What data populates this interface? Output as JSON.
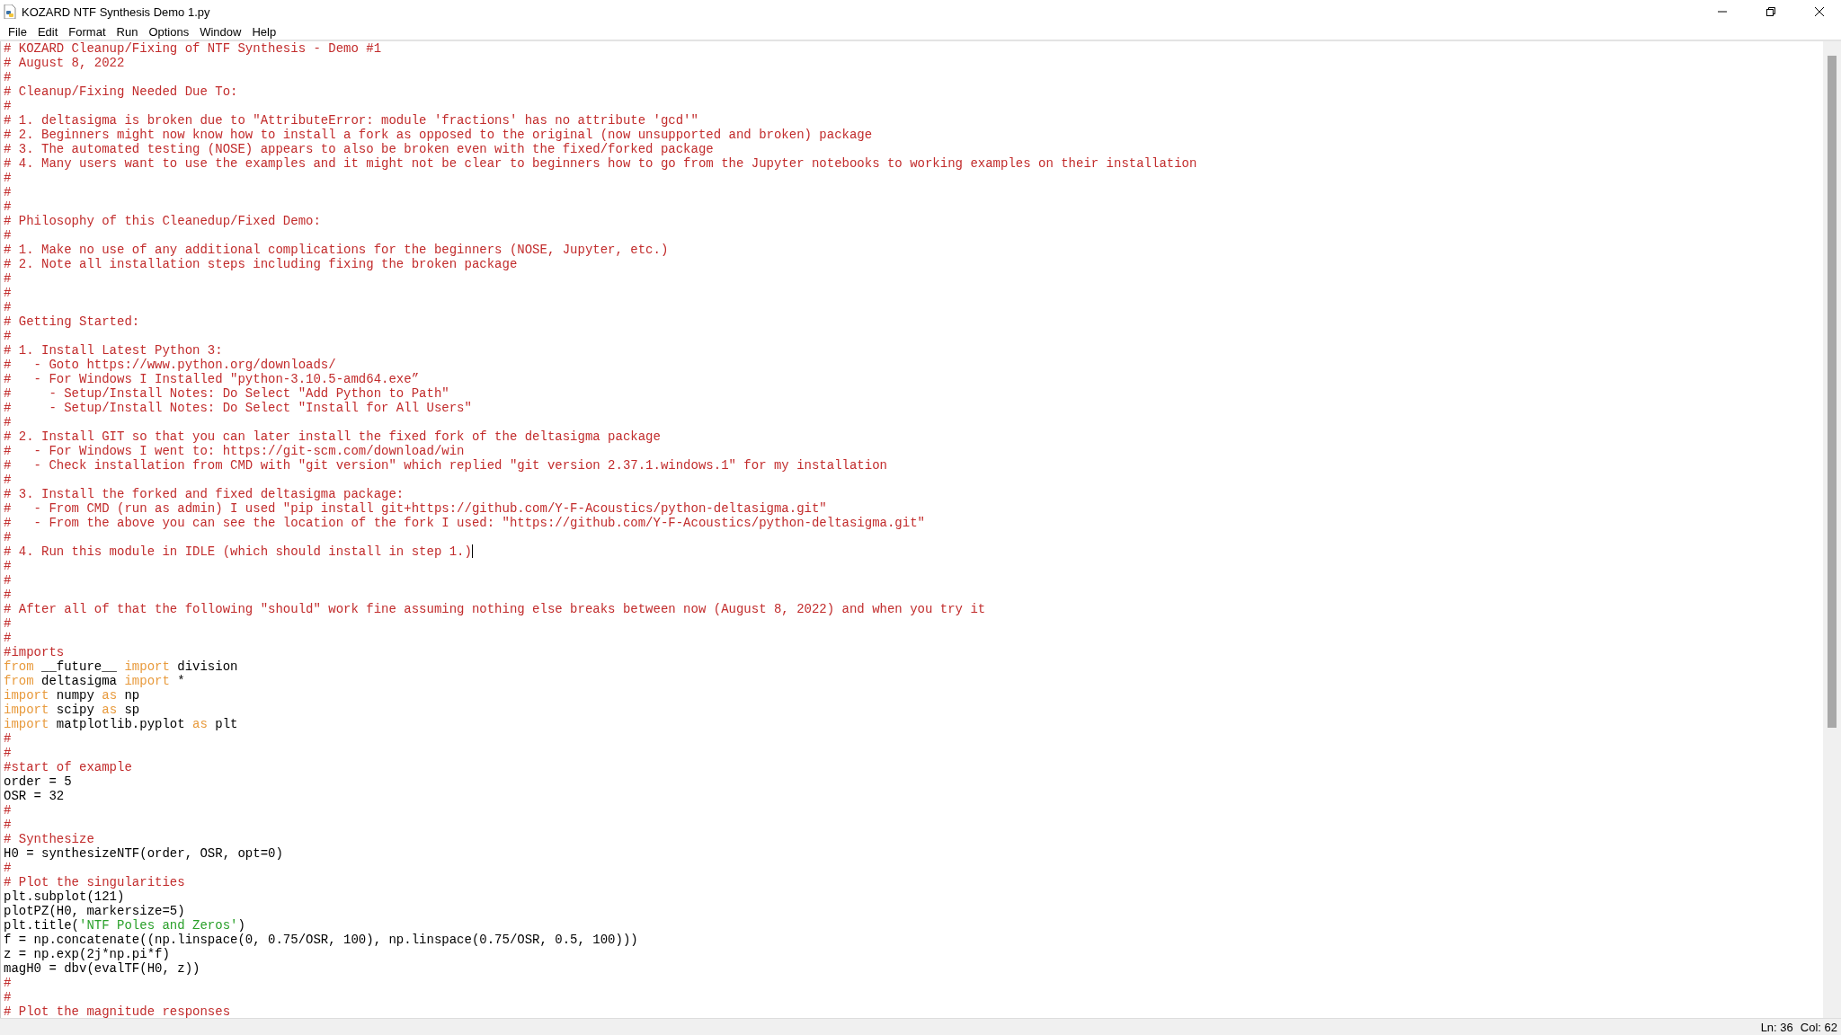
{
  "window": {
    "title": "KOZARD NTF Synthesis Demo 1.py"
  },
  "menu": [
    "File",
    "Edit",
    "Format",
    "Run",
    "Options",
    "Window",
    "Help"
  ],
  "lines": [
    {
      "tokens": [
        {
          "kind": "comment",
          "text": "# KOZARD Cleanup/Fixing of NTF Synthesis - Demo #1"
        }
      ]
    },
    {
      "tokens": [
        {
          "kind": "comment",
          "text": "# August 8, 2022"
        }
      ]
    },
    {
      "tokens": [
        {
          "kind": "comment",
          "text": "#"
        }
      ]
    },
    {
      "tokens": [
        {
          "kind": "comment",
          "text": "# Cleanup/Fixing Needed Due To:"
        }
      ]
    },
    {
      "tokens": [
        {
          "kind": "comment",
          "text": "#"
        }
      ]
    },
    {
      "tokens": [
        {
          "kind": "comment",
          "text": "# 1. deltasigma is broken due to \"AttributeError: module 'fractions' has no attribute 'gcd'\""
        }
      ]
    },
    {
      "tokens": [
        {
          "kind": "comment",
          "text": "# 2. Beginners might now know how to install a fork as opposed to the original (now unsupported and broken) package"
        }
      ]
    },
    {
      "tokens": [
        {
          "kind": "comment",
          "text": "# 3. The automated testing (NOSE) appears to also be broken even with the fixed/forked package"
        }
      ]
    },
    {
      "tokens": [
        {
          "kind": "comment",
          "text": "# 4. Many users want to use the examples and it might not be clear to beginners how to go from the Jupyter notebooks to working examples on their installation"
        }
      ]
    },
    {
      "tokens": [
        {
          "kind": "comment",
          "text": "#"
        }
      ]
    },
    {
      "tokens": [
        {
          "kind": "comment",
          "text": "#"
        }
      ]
    },
    {
      "tokens": [
        {
          "kind": "comment",
          "text": "#"
        }
      ]
    },
    {
      "tokens": [
        {
          "kind": "comment",
          "text": "# Philosophy of this Cleanedup/Fixed Demo:"
        }
      ]
    },
    {
      "tokens": [
        {
          "kind": "comment",
          "text": "#"
        }
      ]
    },
    {
      "tokens": [
        {
          "kind": "comment",
          "text": "# 1. Make no use of any additional complications for the beginners (NOSE, Jupyter, etc.)"
        }
      ]
    },
    {
      "tokens": [
        {
          "kind": "comment",
          "text": "# 2. Note all installation steps including fixing the broken package"
        }
      ]
    },
    {
      "tokens": [
        {
          "kind": "comment",
          "text": "#"
        }
      ]
    },
    {
      "tokens": [
        {
          "kind": "comment",
          "text": "#"
        }
      ]
    },
    {
      "tokens": [
        {
          "kind": "comment",
          "text": "#"
        }
      ]
    },
    {
      "tokens": [
        {
          "kind": "comment",
          "text": "# Getting Started:"
        }
      ]
    },
    {
      "tokens": [
        {
          "kind": "comment",
          "text": "#"
        }
      ]
    },
    {
      "tokens": [
        {
          "kind": "comment",
          "text": "# 1. Install Latest Python 3:"
        }
      ]
    },
    {
      "tokens": [
        {
          "kind": "comment",
          "text": "#   - Goto https://www.python.org/downloads/"
        }
      ]
    },
    {
      "tokens": [
        {
          "kind": "comment",
          "text": "#   - For Windows I Installed \"python-3.10.5-amd64.exe”"
        }
      ]
    },
    {
      "tokens": [
        {
          "kind": "comment",
          "text": "#     - Setup/Install Notes: Do Select \"Add Python to Path\""
        }
      ]
    },
    {
      "tokens": [
        {
          "kind": "comment",
          "text": "#     - Setup/Install Notes: Do Select \"Install for All Users\""
        }
      ]
    },
    {
      "tokens": [
        {
          "kind": "comment",
          "text": "#"
        }
      ]
    },
    {
      "tokens": [
        {
          "kind": "comment",
          "text": "# 2. Install GIT so that you can later install the fixed fork of the deltasigma package"
        }
      ]
    },
    {
      "tokens": [
        {
          "kind": "comment",
          "text": "#   - For Windows I went to: https://git-scm.com/download/win"
        }
      ]
    },
    {
      "tokens": [
        {
          "kind": "comment",
          "text": "#   - Check installation from CMD with \"git version\" which replied \"git version 2.37.1.windows.1\" for my installation"
        }
      ]
    },
    {
      "tokens": [
        {
          "kind": "comment",
          "text": "#"
        }
      ]
    },
    {
      "tokens": [
        {
          "kind": "comment",
          "text": "# 3. Install the forked and fixed deltasigma package:"
        }
      ]
    },
    {
      "tokens": [
        {
          "kind": "comment",
          "text": "#   - From CMD (run as admin) I used \"pip install git+https://github.com/Y-F-Acoustics/python-deltasigma.git\""
        }
      ]
    },
    {
      "tokens": [
        {
          "kind": "comment",
          "text": "#   - From the above you can see the location of the fork I used: \"https://github.com/Y-F-Acoustics/python-deltasigma.git\""
        }
      ]
    },
    {
      "tokens": [
        {
          "kind": "comment",
          "text": "#"
        }
      ]
    },
    {
      "tokens": [
        {
          "kind": "comment",
          "text": "# 4. Run this module in IDLE (which should install in step 1.)"
        }
      ],
      "caret": true
    },
    {
      "tokens": [
        {
          "kind": "comment",
          "text": "#"
        }
      ]
    },
    {
      "tokens": [
        {
          "kind": "comment",
          "text": "#"
        }
      ]
    },
    {
      "tokens": [
        {
          "kind": "comment",
          "text": "#"
        }
      ]
    },
    {
      "tokens": [
        {
          "kind": "comment",
          "text": "# After all of that the following \"should\" work fine assuming nothing else breaks between now (August 8, 2022) and when you try it"
        }
      ]
    },
    {
      "tokens": [
        {
          "kind": "comment",
          "text": "#"
        }
      ]
    },
    {
      "tokens": [
        {
          "kind": "comment",
          "text": "#"
        }
      ]
    },
    {
      "tokens": [
        {
          "kind": "comment",
          "text": "#imports"
        }
      ]
    },
    {
      "tokens": [
        {
          "kind": "keyword",
          "text": "from"
        },
        {
          "kind": "plain",
          "text": " __future__ "
        },
        {
          "kind": "keyword",
          "text": "import"
        },
        {
          "kind": "plain",
          "text": " division"
        }
      ]
    },
    {
      "tokens": [
        {
          "kind": "keyword",
          "text": "from"
        },
        {
          "kind": "plain",
          "text": " deltasigma "
        },
        {
          "kind": "keyword",
          "text": "import"
        },
        {
          "kind": "plain",
          "text": " *"
        }
      ]
    },
    {
      "tokens": [
        {
          "kind": "keyword",
          "text": "import"
        },
        {
          "kind": "plain",
          "text": " numpy "
        },
        {
          "kind": "keyword",
          "text": "as"
        },
        {
          "kind": "plain",
          "text": " np"
        }
      ]
    },
    {
      "tokens": [
        {
          "kind": "keyword",
          "text": "import"
        },
        {
          "kind": "plain",
          "text": " scipy "
        },
        {
          "kind": "keyword",
          "text": "as"
        },
        {
          "kind": "plain",
          "text": " sp"
        }
      ]
    },
    {
      "tokens": [
        {
          "kind": "keyword",
          "text": "import"
        },
        {
          "kind": "plain",
          "text": " matplotlib.pyplot "
        },
        {
          "kind": "keyword",
          "text": "as"
        },
        {
          "kind": "plain",
          "text": " plt"
        }
      ]
    },
    {
      "tokens": [
        {
          "kind": "comment",
          "text": "#"
        }
      ]
    },
    {
      "tokens": [
        {
          "kind": "comment",
          "text": "#"
        }
      ]
    },
    {
      "tokens": [
        {
          "kind": "comment",
          "text": "#start of example"
        }
      ]
    },
    {
      "tokens": [
        {
          "kind": "plain",
          "text": "order = 5"
        }
      ]
    },
    {
      "tokens": [
        {
          "kind": "plain",
          "text": "OSR = 32"
        }
      ]
    },
    {
      "tokens": [
        {
          "kind": "comment",
          "text": "#"
        }
      ]
    },
    {
      "tokens": [
        {
          "kind": "comment",
          "text": "#"
        }
      ]
    },
    {
      "tokens": [
        {
          "kind": "comment",
          "text": "# Synthesize"
        }
      ]
    },
    {
      "tokens": [
        {
          "kind": "plain",
          "text": "H0 = synthesizeNTF(order, OSR, opt=0)"
        }
      ]
    },
    {
      "tokens": [
        {
          "kind": "comment",
          "text": "#"
        }
      ]
    },
    {
      "tokens": [
        {
          "kind": "comment",
          "text": "# Plot the singularities"
        }
      ]
    },
    {
      "tokens": [
        {
          "kind": "plain",
          "text": "plt.subplot(121)"
        }
      ]
    },
    {
      "tokens": [
        {
          "kind": "plain",
          "text": "plotPZ(H0, markersize=5)"
        }
      ]
    },
    {
      "tokens": [
        {
          "kind": "plain",
          "text": "plt.title("
        },
        {
          "kind": "string",
          "text": "'NTF Poles and Zeros'"
        },
        {
          "kind": "plain",
          "text": ")"
        }
      ]
    },
    {
      "tokens": [
        {
          "kind": "plain",
          "text": "f = np.concatenate((np.linspace(0, 0.75/OSR, 100), np.linspace(0.75/OSR, 0.5, 100)))"
        }
      ]
    },
    {
      "tokens": [
        {
          "kind": "plain",
          "text": "z = np.exp(2j*np.pi*f)"
        }
      ]
    },
    {
      "tokens": [
        {
          "kind": "plain",
          "text": "magH0 = dbv(evalTF(H0, z))"
        }
      ]
    },
    {
      "tokens": [
        {
          "kind": "comment",
          "text": "#"
        }
      ]
    },
    {
      "tokens": [
        {
          "kind": "comment",
          "text": "#"
        }
      ]
    },
    {
      "tokens": [
        {
          "kind": "comment",
          "text": "# Plot the magnitude responses"
        }
      ]
    }
  ],
  "status_bar": {
    "line": "Ln: 36",
    "column": "Col: 62"
  }
}
